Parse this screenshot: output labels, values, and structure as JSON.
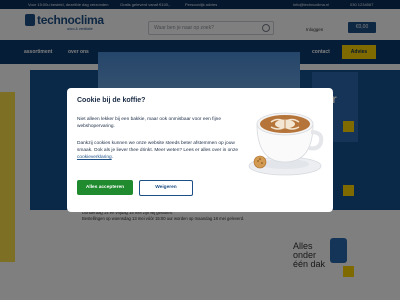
{
  "topbar": {
    "items": [
      "Voor 15:00u besteld, dezelfde dag verzonden",
      "Gratis geleverd vanaf €100,-",
      "Persoonlijk advies",
      "info@technoclima.nl",
      "030 1234567"
    ]
  },
  "header": {
    "logo_text": "technoclima",
    "logo_sub": "airco & ventilatie",
    "search_placeholder": "Waar ben je naar op zoek?",
    "login_label": "Inloggen",
    "cart_label": "€0,00"
  },
  "nav": {
    "items": [
      "assortiment",
      "over ons",
      "contact"
    ],
    "cta_label": "Advies"
  },
  "background": {
    "banner_text": "ier",
    "notice_line1": "Donderdag 14 en vrijdag 15 mei zijn wij gesloten.",
    "notice_line2": "Bestellingen op woensdag 13 mei vóór 15:00 uur worden op maandag 18 mei geleverd.",
    "side_title": "Alles onder één dak"
  },
  "cookie_modal": {
    "title": "Cookie bij de koffie?",
    "paragraph1": "Niet alleen lekker bij een bakkie, maar ook onmisbaar voor een fijne webshopervaring.",
    "paragraph2_prefix": "Dankzij cookies kunnen we onze website steeds beter afstemmen op jouw smaak. Ook als je liever thee drinkt. Meer weten? Lees er alles over in onze ",
    "paragraph2_link": "cookieverklaring",
    "paragraph2_suffix": ".",
    "accept_label": "Alles accepteren",
    "deny_label": "Weigeren"
  },
  "colors": {
    "brand_blue": "#0d3a6e",
    "accent_yellow": "#ffd400",
    "accept_green": "#1f8b2e"
  }
}
